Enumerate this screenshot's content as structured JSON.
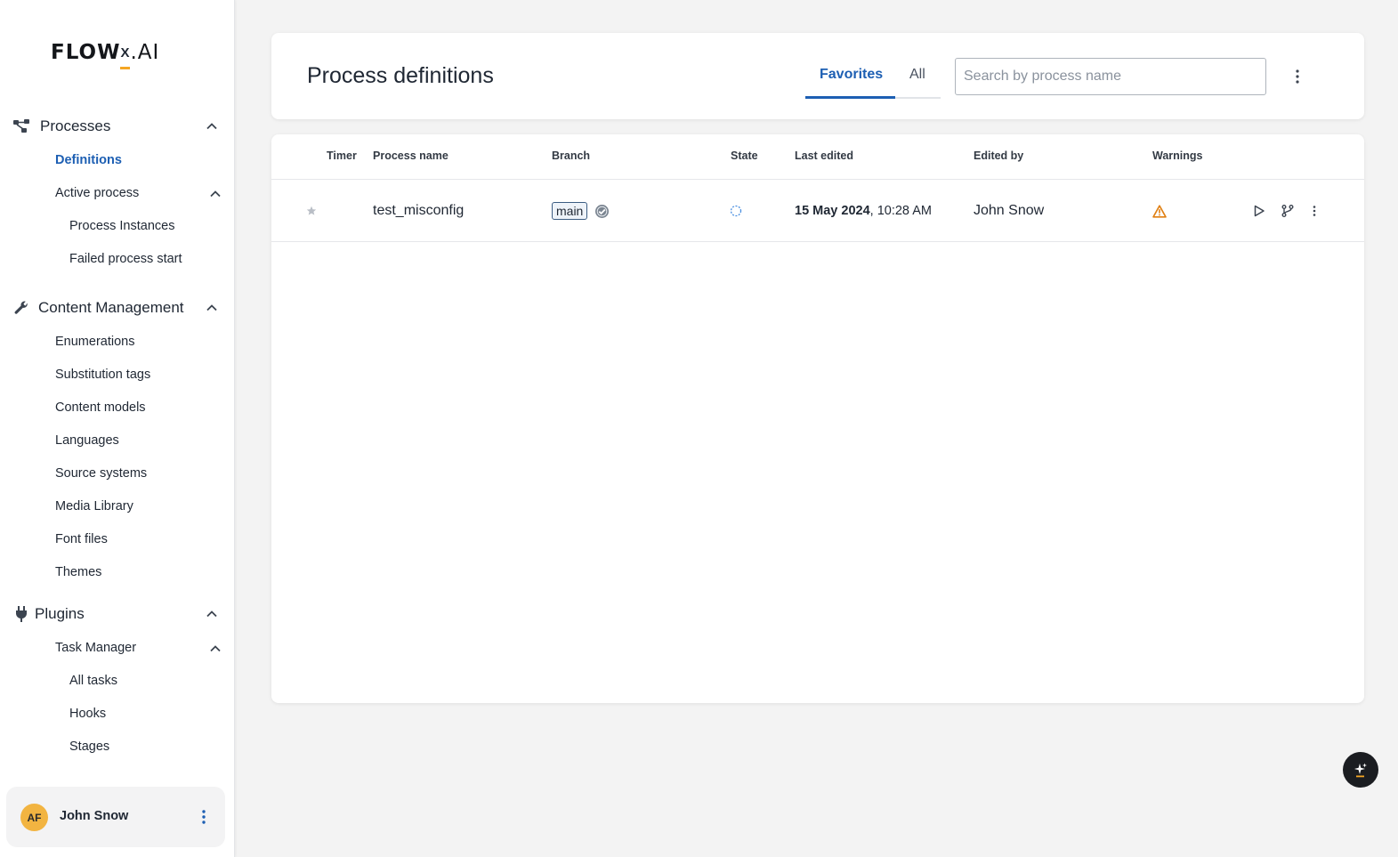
{
  "brand": {
    "logo_main": "FLOW",
    "logo_x": "X",
    "logo_ai": ".AI",
    "accent_color": "#f5a623"
  },
  "sidebar": {
    "sections": [
      {
        "label": "Processes",
        "icon": "process-icon"
      },
      {
        "label": "Content Management",
        "icon": "wrench-icon"
      },
      {
        "label": "Plugins",
        "icon": "plug-icon"
      }
    ],
    "items": {
      "definitions": "Definitions",
      "active_process": "Active process",
      "process_instances": "Process Instances",
      "failed_process_start": "Failed process start",
      "enumerations": "Enumerations",
      "substitution_tags": "Substitution tags",
      "content_models": "Content models",
      "languages": "Languages",
      "source_systems": "Source systems",
      "media_library": "Media Library",
      "font_files": "Font files",
      "themes": "Themes",
      "task_manager": "Task Manager",
      "all_tasks": "All tasks",
      "hooks": "Hooks",
      "stages": "Stages"
    },
    "active_color": "#1d5fb3"
  },
  "user": {
    "initials": "AF",
    "name": "John Snow"
  },
  "header": {
    "title": "Process definitions",
    "tabs": [
      {
        "label": "Favorites"
      },
      {
        "label": "All"
      }
    ],
    "search_placeholder": "Search by process name"
  },
  "table": {
    "columns": [
      "Timer",
      "Process name",
      "Branch",
      "State",
      "Last edited",
      "Edited by",
      "Warnings"
    ],
    "rows": [
      {
        "process_name": "test_misconfig",
        "branch": "main",
        "last_edited_date": "15 May 2024",
        "last_edited_time": ", 10:28 AM",
        "edited_by": "John Snow",
        "warning_icon": "warning-triangle-icon"
      }
    ]
  }
}
